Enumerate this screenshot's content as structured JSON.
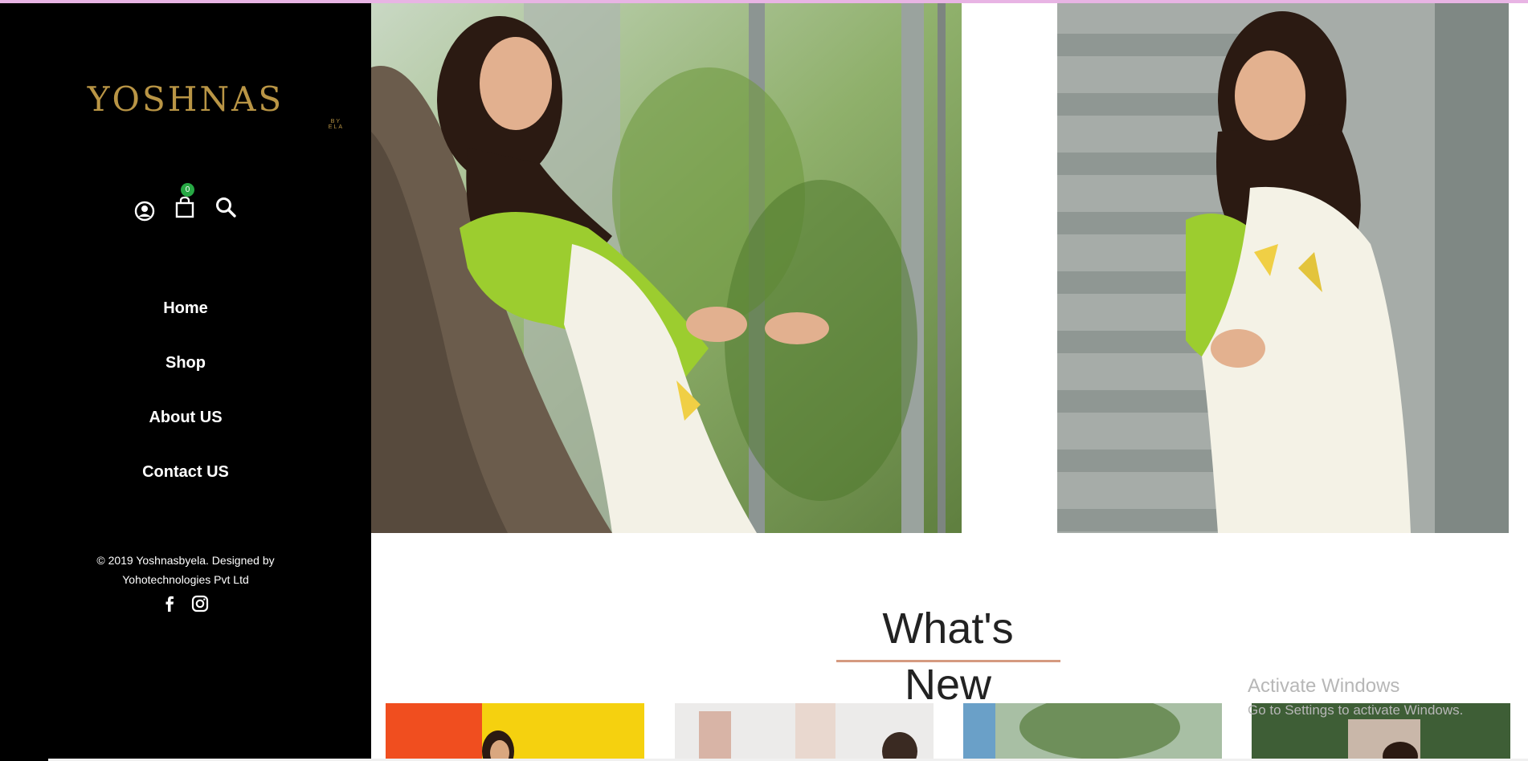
{
  "brand": {
    "name": "YOSHNAS",
    "tagline": "BY ELA",
    "color": "#b99545"
  },
  "header_icons": {
    "account": "user-circle-icon",
    "cart": "shopping-bag-icon",
    "cart_count": "0",
    "search": "search-icon",
    "badge_color": "#27a844"
  },
  "nav": {
    "items": [
      {
        "label": "Home"
      },
      {
        "label": "Shop"
      },
      {
        "label": "About US"
      },
      {
        "label": "Contact US"
      }
    ]
  },
  "footer": {
    "copyright_line1": "© 2019 Yoshnasbyela. Designed by",
    "copyright_line2": "Yohotechnologies Pvt Ltd",
    "social": [
      "facebook-icon",
      "instagram-icon"
    ]
  },
  "section": {
    "title": "What's New",
    "underline_color": "#d59a80"
  },
  "watermark": {
    "line1": "Activate Windows",
    "line2": "Go to Settings to activate Windows."
  }
}
